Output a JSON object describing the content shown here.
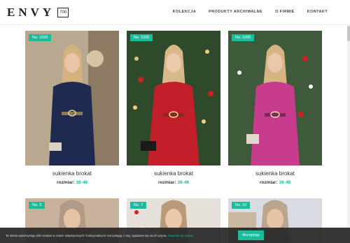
{
  "header": {
    "logo": "ENVY",
    "logo_badge": "700",
    "nav": [
      "KOLEKCJA",
      "PRODUKTY ARCHIWALNE",
      "O FIRMIE",
      "KONTAKT"
    ]
  },
  "flags": [
    {
      "name": "pl-flag",
      "color": "#d22"
    },
    {
      "name": "en-flag",
      "color": "#236"
    },
    {
      "name": "de-flag",
      "color": "#222"
    },
    {
      "name": "ru-flag",
      "color": "#248"
    },
    {
      "name": "fr-flag",
      "color": "#238"
    }
  ],
  "products": [
    {
      "badge": "No. 1009",
      "title": "sukienka brokat",
      "size_label": "rozmiar:",
      "size_value": "38-48",
      "dress_color": "#1e2a4f",
      "bg": "#b7a88f"
    },
    {
      "badge": "No. 1006",
      "title": "sukienka brokat",
      "size_label": "rozmiar:",
      "size_value": "38-48",
      "dress_color": "#c21f2a",
      "bg": "#2f4a2a"
    },
    {
      "badge": "No. 1005",
      "title": "sukienka brokat",
      "size_label": "rozmiar:",
      "size_value": "38-48",
      "dress_color": "#c83c8d",
      "bg": "#3e5a3a"
    },
    {
      "badge": "No. 3",
      "title": "",
      "size_label": "",
      "size_value": "",
      "dress_color": "#b19a86",
      "bg": "#c9b29b"
    },
    {
      "badge": "No. 7",
      "title": "",
      "size_label": "",
      "size_value": "",
      "dress_color": "#d8d0c8",
      "bg": "#e5e0da"
    },
    {
      "badge": "No. 10",
      "title": "",
      "size_label": "",
      "size_value": "",
      "dress_color": "#bba58f",
      "bg": "#d8dce2"
    }
  ],
  "cookie": {
    "text": "Ta strona wykorzystuje pliki cookies w celach statystycznych i funkcjonalnych. Korzystając z niej, zgadzasz się na ich użycie.",
    "link": "Dowiedz się więcej.",
    "button": "Akceptuję"
  },
  "colors": {
    "accent": "#1abc9c"
  }
}
